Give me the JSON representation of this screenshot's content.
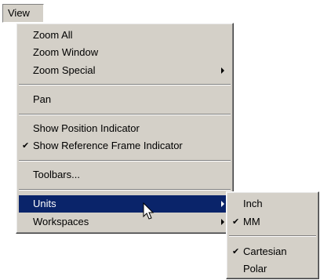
{
  "menubar": {
    "view_label": "View"
  },
  "view_menu": {
    "items": [
      {
        "label": "Zoom All"
      },
      {
        "label": "Zoom Window"
      },
      {
        "label": "Zoom Special"
      },
      {
        "label": "Pan"
      },
      {
        "label": "Show Position Indicator"
      },
      {
        "label": "Show Reference Frame Indicator",
        "checked": true
      },
      {
        "label": "Toolbars..."
      },
      {
        "label": "Units",
        "highlighted": true
      },
      {
        "label": "Workspaces"
      }
    ]
  },
  "units_submenu": {
    "items": [
      {
        "label": "Inch"
      },
      {
        "label": "MM",
        "checked": true
      },
      {
        "label": "Cartesian",
        "checked": true
      },
      {
        "label": "Polar"
      }
    ]
  },
  "colors": {
    "menu_face": "#d4d0c8",
    "highlight": "#0a246a",
    "highlight_text": "#ffffff"
  },
  "icons": [
    "checkmark-icon",
    "submenu-arrow-icon",
    "mouse-pointer-icon"
  ]
}
